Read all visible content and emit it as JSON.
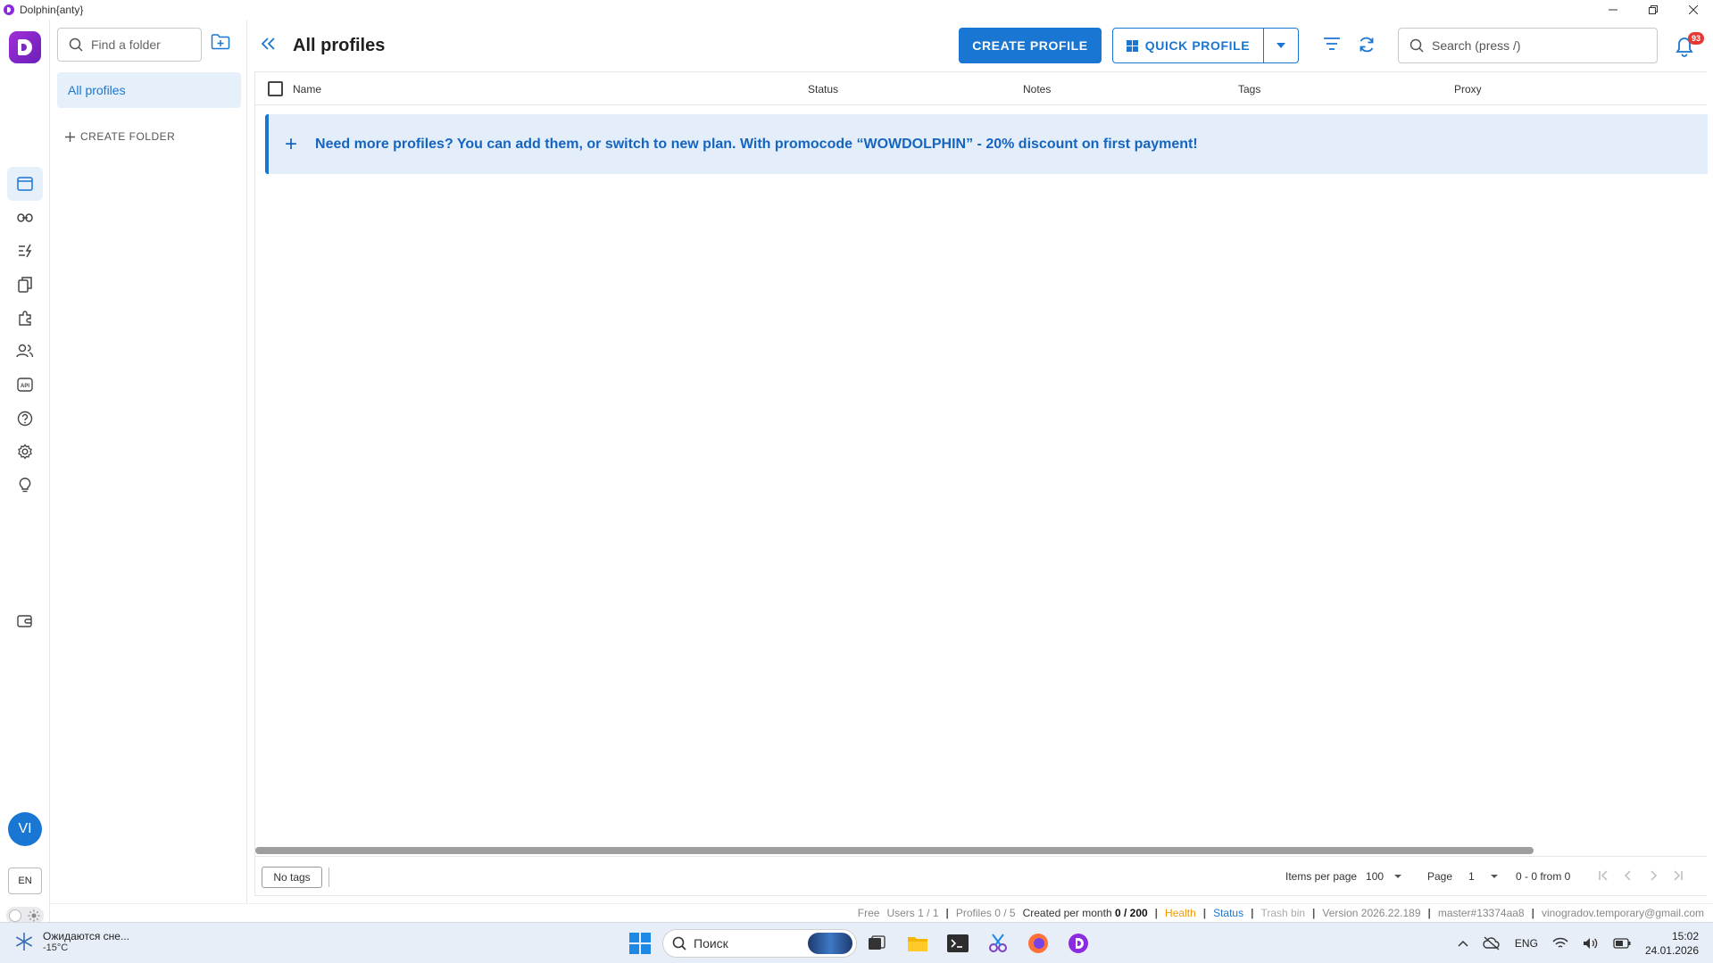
{
  "window": {
    "title": "Dolphin{anty}"
  },
  "folders": {
    "search_placeholder": "Find a folder",
    "all_profiles": "All profiles",
    "create_folder": "CREATE FOLDER"
  },
  "header": {
    "title": "All profiles",
    "create_profile": "CREATE PROFILE",
    "quick_profile": "QUICK PROFILE",
    "search_placeholder": "Search (press /)",
    "notification_count": "93"
  },
  "table": {
    "columns": [
      "Name",
      "Status",
      "Notes",
      "Tags",
      "Proxy"
    ],
    "promo": "Need more profiles? You can add them, or switch to new plan. With promocode “WOWDOLPHIN” - 20% discount on first payment!",
    "promo_icon": "+"
  },
  "footer": {
    "no_tags": "No tags",
    "items_per_page_label": "Items per page",
    "items_per_page_value": "100",
    "page_label": "Page",
    "page_value": "1",
    "range": "0 - 0 from 0"
  },
  "rail": {
    "avatar": "VI",
    "language": "EN",
    "icons": [
      "browser-profiles-icon",
      "link-icon",
      "automation-icon",
      "copy-icon",
      "extensions-icon",
      "users-icon",
      "api-icon",
      "help-icon",
      "settings-icon",
      "lightbulb-icon",
      "wallet-icon"
    ]
  },
  "statusbar": {
    "plan": "Free",
    "users": "Users 1 / 1",
    "profiles": "Profiles 0 / 5",
    "created_label": "Created per month",
    "created_value": "0 / 200",
    "health": "Health",
    "status": "Status",
    "trash": "Trash bin",
    "version": "Version 2026.22.189",
    "branch": "master#13374aa8",
    "email": "vinogradov.temporary@gmail.com"
  },
  "taskbar": {
    "weather_text": "Ожидаются сне...",
    "weather_temp": "-15°C",
    "search": "Поиск",
    "lang": "ENG",
    "time": "15:02",
    "date": "24.01.2026"
  },
  "colors": {
    "accent": "#1976d2",
    "brand": "#7b2cbf",
    "promo_bg": "#e3eefa",
    "badge": "#e53935",
    "health": "#f29900"
  }
}
